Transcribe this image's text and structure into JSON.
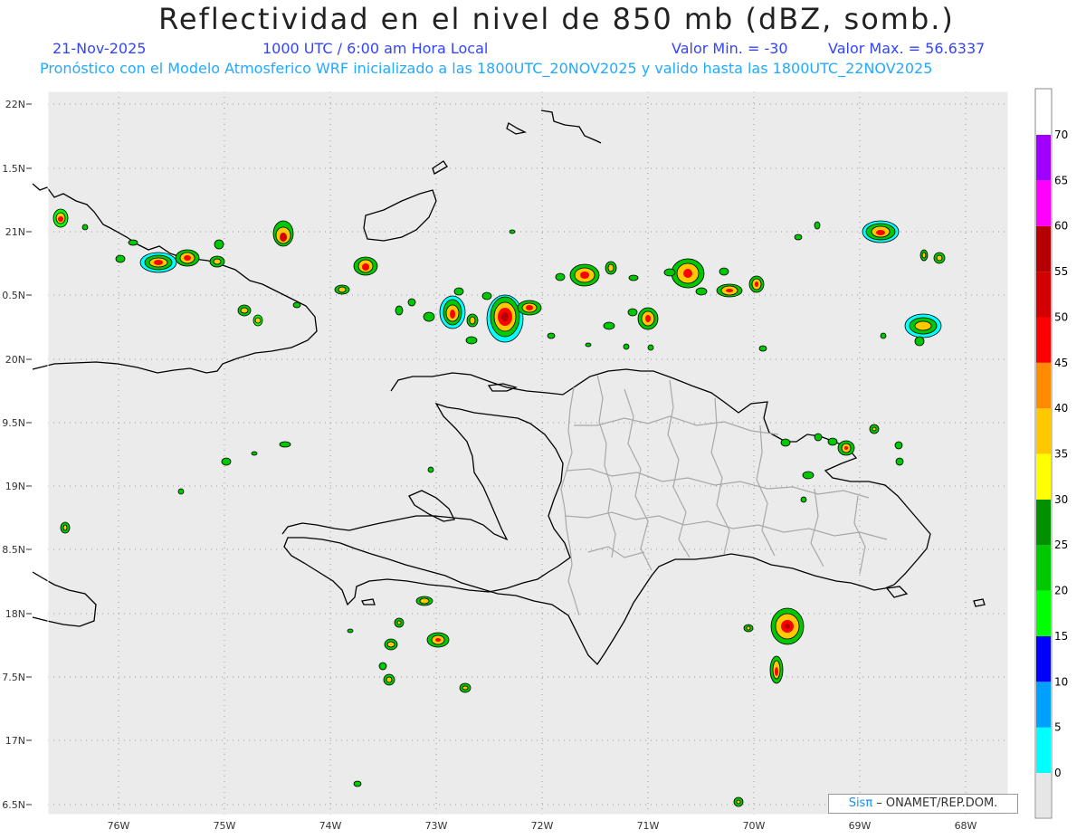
{
  "header": {
    "title": "Reflectividad en el nivel de 850 mb (dBZ, somb.)",
    "date": "21-Nov-2025",
    "time": "1000 UTC / 6:00 am Hora Local",
    "vmin": "Valor Min. = -30",
    "vmax": "Valor Max. = 56.6337",
    "description": "Pronóstico con el Modelo Atmosferico WRF inicializado a las 1800UTC_20NOV2025 y valido hasta las  1800UTC_22NOV2025"
  },
  "map": {
    "lon_range": [
      -76.7,
      -67.55
    ],
    "lat_range": [
      6.4,
      22.1
    ],
    "lat_labels": [
      "22N",
      "1.5N",
      "21N",
      "0.5N",
      "20N",
      "9.5N",
      "19N",
      "8.5N",
      "18N",
      "7.5N",
      "17N",
      "6.5N"
    ],
    "lon_labels": [
      "76W",
      "75W",
      "74W",
      "73W",
      "72W",
      "71W",
      "70W",
      "69W",
      "68W"
    ],
    "background_color": "#ebebeb",
    "grid": "dotted"
  },
  "colorbar": {
    "levels": [
      "0",
      "5",
      "10",
      "15",
      "20",
      "25",
      "30",
      "35",
      "40",
      "45",
      "50",
      "55",
      "60",
      "65",
      "70"
    ],
    "colors": [
      "#00ffff",
      "#00a0ff",
      "#0000ff",
      "#00ff00",
      "#00c800",
      "#009000",
      "#ffff00",
      "#ffc800",
      "#ff8c00",
      "#ff0000",
      "#d20000",
      "#b40000",
      "#ff00ff",
      "#a000ff"
    ]
  },
  "credit": {
    "logo": "Sisπ",
    "text": " – ONAMET/REP.DOM."
  }
}
